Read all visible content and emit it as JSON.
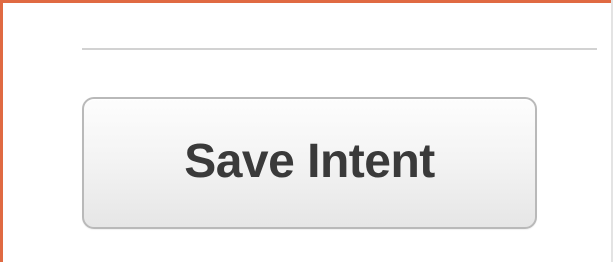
{
  "form": {
    "save_button_label": "Save Intent"
  }
}
